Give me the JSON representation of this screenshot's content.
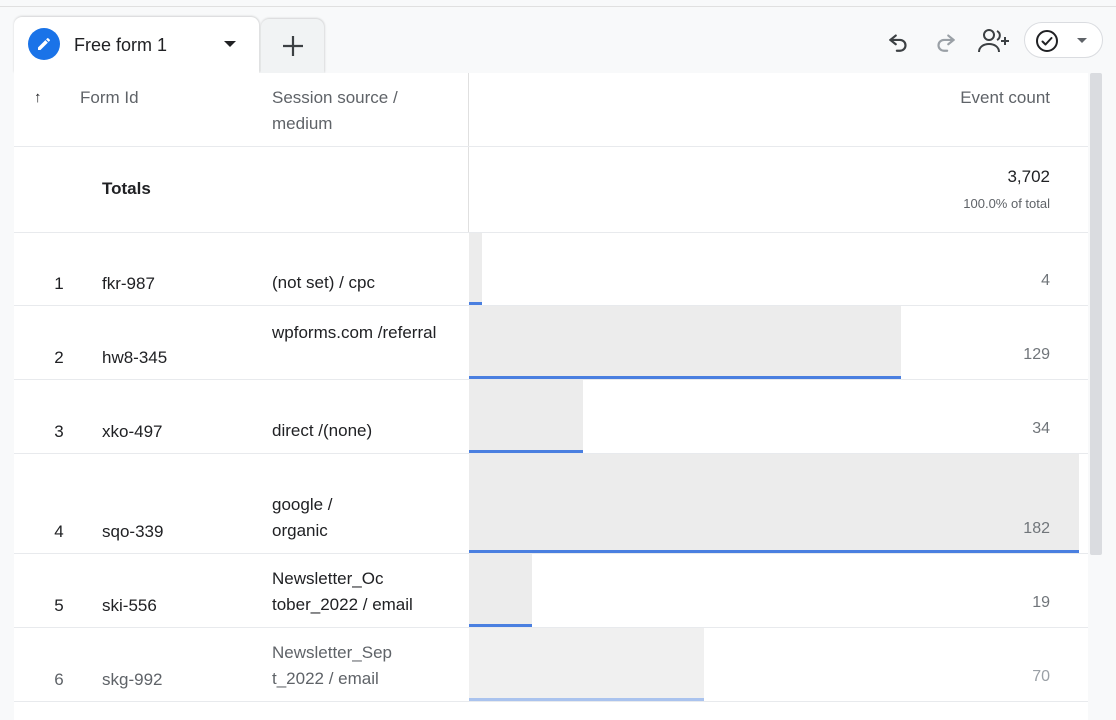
{
  "tabs": {
    "active_label": "Free form 1",
    "add_icon": "plus-icon",
    "active_icon": "pencil-icon"
  },
  "toolbar": {
    "undo_icon": "undo-icon",
    "redo_icon": "redo-icon",
    "share_icon": "add-person-icon",
    "status_icon": "check-circle-icon"
  },
  "table": {
    "columns": {
      "sort_arrow": "↑",
      "form_id": "Form Id",
      "source_line1": "Session source /",
      "source_line2": "medium",
      "event_count": "Event count"
    },
    "totals": {
      "label": "Totals",
      "value": "3,702",
      "percent": "100.0% of total"
    },
    "max_value": 182,
    "rows": [
      {
        "index": "1",
        "form_id": "fkr-987",
        "source": [
          "(not set) / cpc"
        ],
        "value": "4",
        "fraction": 0.022
      },
      {
        "index": "2",
        "form_id": "hw8-345",
        "source": [
          "wpforms.com /referral"
        ],
        "value": "129",
        "fraction": 0.709
      },
      {
        "index": "3",
        "form_id": "xko-497",
        "source": [
          "direct /(none)"
        ],
        "value": "34",
        "fraction": 0.187
      },
      {
        "index": "4",
        "form_id": "sqo-339",
        "source": [
          "google /",
          "organic"
        ],
        "value": "182",
        "fraction": 1.0
      },
      {
        "index": "5",
        "form_id": "ski-556",
        "source": [
          "Newsletter_Oc",
          "tober_2022 / email"
        ],
        "value": "19",
        "fraction": 0.104
      },
      {
        "index": "6",
        "form_id": "skg-992",
        "source": [
          "Newsletter_Sep",
          "t_2022 / email"
        ],
        "value": "70",
        "fraction": 0.385
      }
    ]
  },
  "colors": {
    "accent": "#1a73e8",
    "bar_line": "#4a7fe0",
    "bar_fill": "#ececec"
  }
}
